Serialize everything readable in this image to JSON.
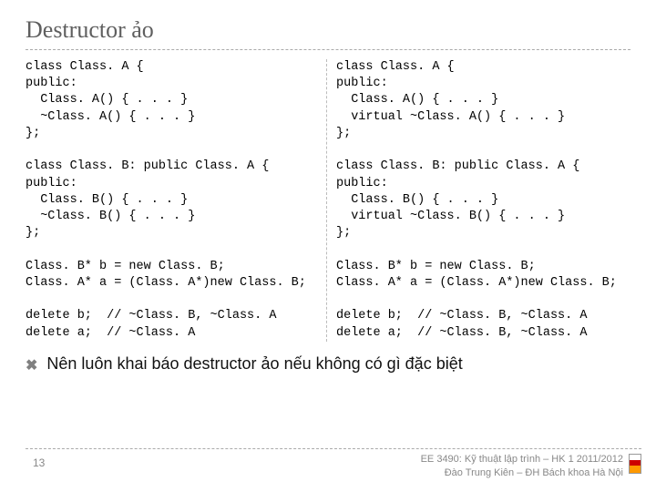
{
  "title": "Destructor ảo",
  "code_left": "class Class. A {\npublic:\n  Class. A() { . . . }\n  ~Class. A() { . . . }\n};\n\nclass Class. B: public Class. A {\npublic:\n  Class. B() { . . . }\n  ~Class. B() { . . . }\n};\n\nClass. B* b = new Class. B;\nClass. A* a = (Class. A*)new Class. B;\n\ndelete b;  // ~Class. B, ~Class. A\ndelete a;  // ~Class. A",
  "code_right": "class Class. A {\npublic:\n  Class. A() { . . . }\n  virtual ~Class. A() { . . . }\n};\n\nclass Class. B: public Class. A {\npublic:\n  Class. B() { . . . }\n  virtual ~Class. B() { . . . }\n};\n\nClass. B* b = new Class. B;\nClass. A* a = (Class. A*)new Class. B;\n\ndelete b;  // ~Class. B, ~Class. A\ndelete a;  // ~Class. B, ~Class. A",
  "bullet_glyph": "✖",
  "note": "Nên luôn khai báo destructor ảo nếu không có gì đặc biệt",
  "page_number": "13",
  "footer_line1": "EE 3490: Kỹ thuật lập trình – HK 1 2011/2012",
  "footer_line2": "Đào Trung Kiên – ĐH Bách khoa Hà Nội"
}
